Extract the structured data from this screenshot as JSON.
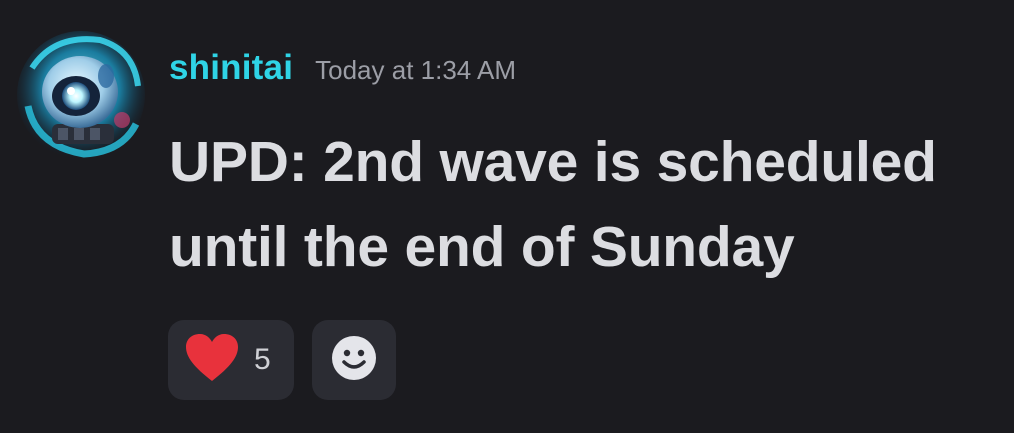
{
  "message": {
    "author": "shinitai",
    "timestamp": "Today at 1:34 AM",
    "text": "UPD: 2nd wave is scheduled until the end of Sunday"
  },
  "reactions": [
    {
      "emoji": "heart-icon",
      "count": "5"
    }
  ],
  "add_reaction": {
    "icon": "smiley-icon"
  },
  "colors": {
    "background": "#1b1b1f",
    "username": "#2fd4e6",
    "timestamp": "#9c9ea6",
    "text": "#dcdde1",
    "reaction_bg": "#2b2c33",
    "heart": "#e8323c"
  }
}
